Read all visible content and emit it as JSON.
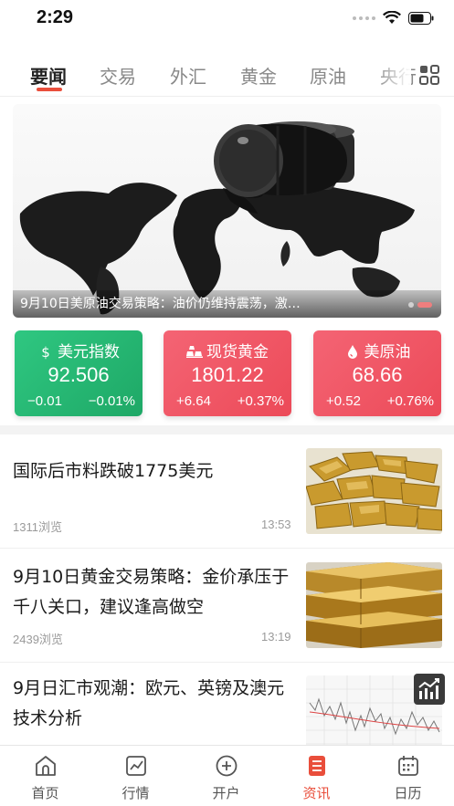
{
  "status_bar": {
    "time": "2:29"
  },
  "tabs": [
    {
      "label": "要闻"
    },
    {
      "label": "交易"
    },
    {
      "label": "外汇"
    },
    {
      "label": "黄金"
    },
    {
      "label": "原油"
    },
    {
      "label": "央行"
    }
  ],
  "banner": {
    "caption": "9月10日美原油交易策略：油价仍维持震荡，激…"
  },
  "quotes": [
    {
      "name": "美元指数",
      "icon": "dollar-icon",
      "value": "92.506",
      "change": "−0.01",
      "percent": "−0.01%",
      "color": "#24b56f"
    },
    {
      "name": "现货黄金",
      "icon": "gold-bars-icon",
      "value": "1801.22",
      "change": "+6.64",
      "percent": "+0.37%",
      "color": "#ef5663"
    },
    {
      "name": "美原油",
      "icon": "oil-drop-icon",
      "value": "68.66",
      "change": "+0.52",
      "percent": "+0.76%",
      "color": "#ef5663"
    }
  ],
  "news": [
    {
      "title": "国际后市料跌破1775美元",
      "views": "1311浏览",
      "time": "13:53",
      "thumb": "gold-nuggets-image"
    },
    {
      "title": "9月10日黄金交易策略：金价承压于千八关口，建议逢高做空",
      "views": "2439浏览",
      "time": "13:19",
      "thumb": "gold-bars-image"
    },
    {
      "title": "9月日汇市观潮：欧元、英镑及澳元技术分析",
      "views": "",
      "time": "",
      "thumb": "forex-chart-image"
    }
  ],
  "bottom_nav": [
    {
      "label": "首页",
      "icon": "home-icon"
    },
    {
      "label": "行情",
      "icon": "market-chart-icon"
    },
    {
      "label": "开户",
      "icon": "plus-circle-icon"
    },
    {
      "label": "资讯",
      "icon": "news-icon"
    },
    {
      "label": "日历",
      "icon": "calendar-icon"
    }
  ],
  "colors": {
    "accent": "#e94e3b",
    "green": "#24b56f",
    "red": "#ef5663"
  }
}
